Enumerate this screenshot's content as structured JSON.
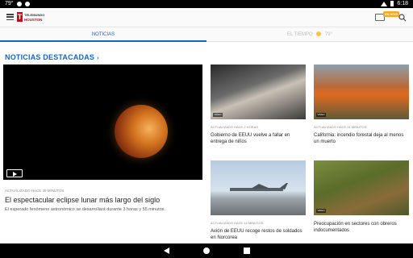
{
  "status_bar": {
    "temp": "79°",
    "time": "6:18"
  },
  "app": {
    "logo_line1": "TELEMUNDO",
    "logo_line2": "HOUSTON",
    "live_badge": "EN VIVO"
  },
  "tabs": {
    "news_label": "NOTICIAS",
    "weather_label": "EL TIEMPO",
    "weather_temp": "79°"
  },
  "section": {
    "title": "NOTICIAS DESTACADAS",
    "chevron": "›"
  },
  "hero": {
    "meta": "ACTUALIZADO HACE 39 MINUTOS",
    "title": "El espectacular eclipse lunar más largo del siglo",
    "summary": "El esperado fenómeno astronómico se desarrollará durante 3 horas y 55 minutos."
  },
  "cards": [
    {
      "meta": "ACTUALIZADO HACE 2 HORAS",
      "title": "Gobierno de EEUU vuelve a fallar en entrega de niños",
      "video_label": "VIDEO"
    },
    {
      "meta": "ACTUALIZADO HACE 51 MINUTOS",
      "title": "California: incendio forestal deja al menos un muerto",
      "video_label": "VIDEO"
    },
    {
      "meta": "ACTUALIZADO HACE 42 MINUTOS",
      "title": "Avión de EEUU recoge restos de soldados en Norcorea",
      "video_label": ""
    },
    {
      "meta": "",
      "title": "Preocupación en sectores con obreros indocumentados",
      "video_label": "VIDEO"
    }
  ]
}
